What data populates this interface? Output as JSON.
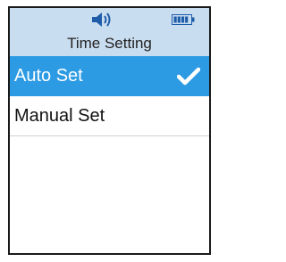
{
  "status_bar": {
    "icons": [
      "speaker-icon",
      "battery-icon"
    ],
    "background": "#c9ddf0",
    "icon_color": "#1f5ca8"
  },
  "header": {
    "title": "Time Setting"
  },
  "menu": {
    "items": [
      {
        "label": "Auto Set",
        "selected": true,
        "icon": "check-icon"
      },
      {
        "label": "Manual Set",
        "selected": false
      }
    ],
    "selected_color": "#2d9be3"
  }
}
